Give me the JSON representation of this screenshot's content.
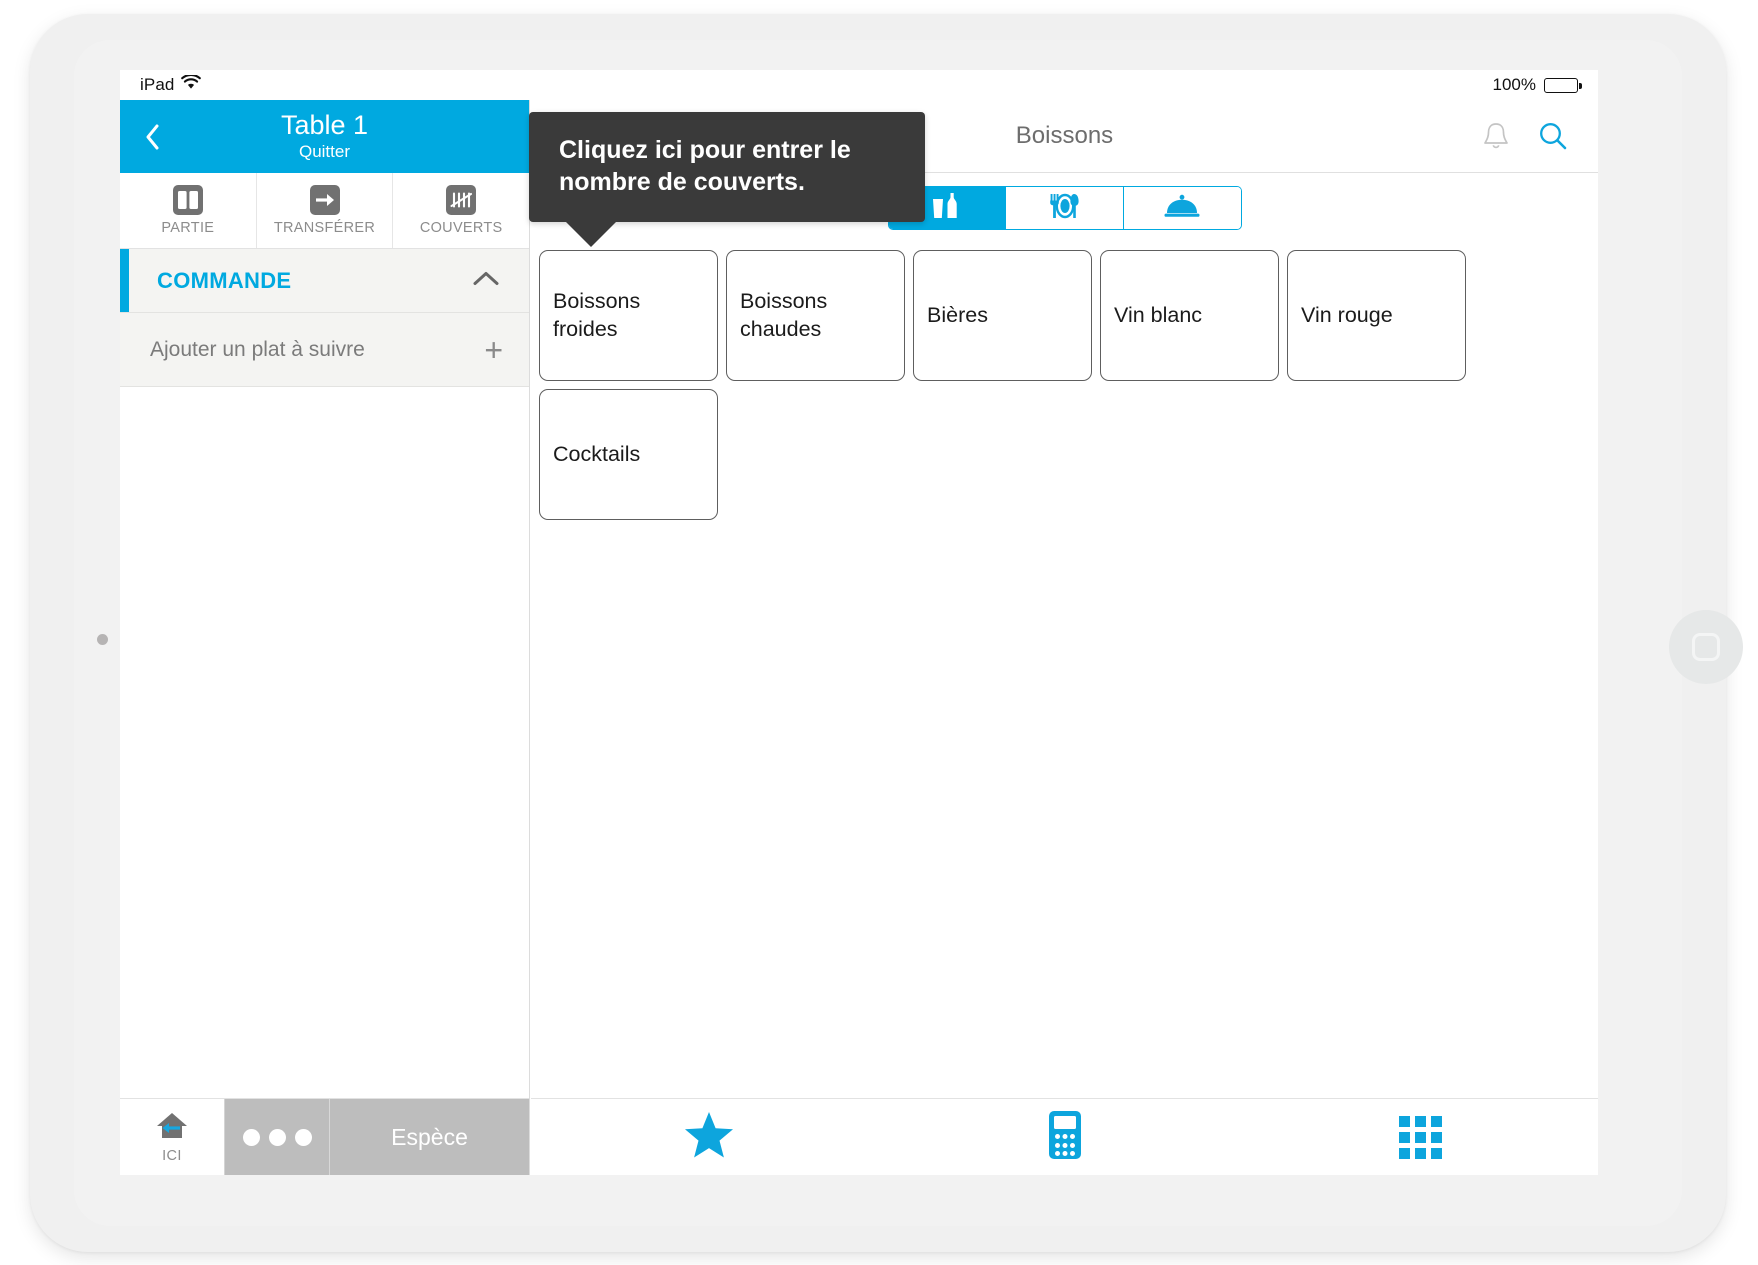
{
  "status_bar": {
    "device": "iPad",
    "wifi_icon": "wifi-icon",
    "battery_percent": "100%",
    "battery_icon": "battery-full-icon"
  },
  "tooltip": {
    "text": "Cliquez ici pour entrer le nombre de couverts.",
    "background_color": "#3a3a3a",
    "points_to": "couverts-button"
  },
  "left_panel": {
    "header": {
      "back_icon": "chevron-left-icon",
      "title": "Table 1",
      "subtitle": "Quitter",
      "background_color": "#00a9e0"
    },
    "actions": [
      {
        "label": "PARTIE",
        "icon": "split-columns-icon"
      },
      {
        "label": "TRANSFÉRER",
        "icon": "arrow-right-icon"
      },
      {
        "label": "COUVERTS",
        "icon": "tally-marks-icon"
      }
    ],
    "order_section": {
      "label": "COMMANDE",
      "accent_color": "#00a9e0",
      "collapse_icon": "chevron-up-icon"
    },
    "add_dish": {
      "label": "Ajouter un plat à suivre",
      "add_icon": "plus-icon"
    },
    "bottom_bar": {
      "here_label": "ICI",
      "here_icon": "home-arrow-icon",
      "more_icon": "ellipsis-icon",
      "payment_label": "Espèce"
    }
  },
  "right_panel": {
    "header": {
      "title": "Boissons",
      "notification_icon": "bell-icon",
      "search_icon": "search-icon"
    },
    "segments": [
      {
        "icon": "drinks-bottle-glass-icon",
        "active": true
      },
      {
        "icon": "cutlery-plate-icon",
        "active": false
      },
      {
        "icon": "cloche-dish-cover-icon",
        "active": false
      }
    ],
    "categories": [
      {
        "label": "Boissons froides"
      },
      {
        "label": "Boissons chaudes"
      },
      {
        "label": "Bières"
      },
      {
        "label": "Vin blanc"
      },
      {
        "label": "Vin rouge"
      },
      {
        "label": "Cocktails"
      }
    ],
    "bottom_tabs": [
      {
        "icon": "star-icon",
        "accent": "#0da5dd"
      },
      {
        "icon": "calculator-icon",
        "accent": "#0da5dd"
      },
      {
        "icon": "grid-apps-icon",
        "accent": "#0da5dd"
      }
    ]
  },
  "theme": {
    "accent": "#00a9e0",
    "grey_button": "#bdbdbd",
    "panel_grey": "#f4f4f2"
  }
}
